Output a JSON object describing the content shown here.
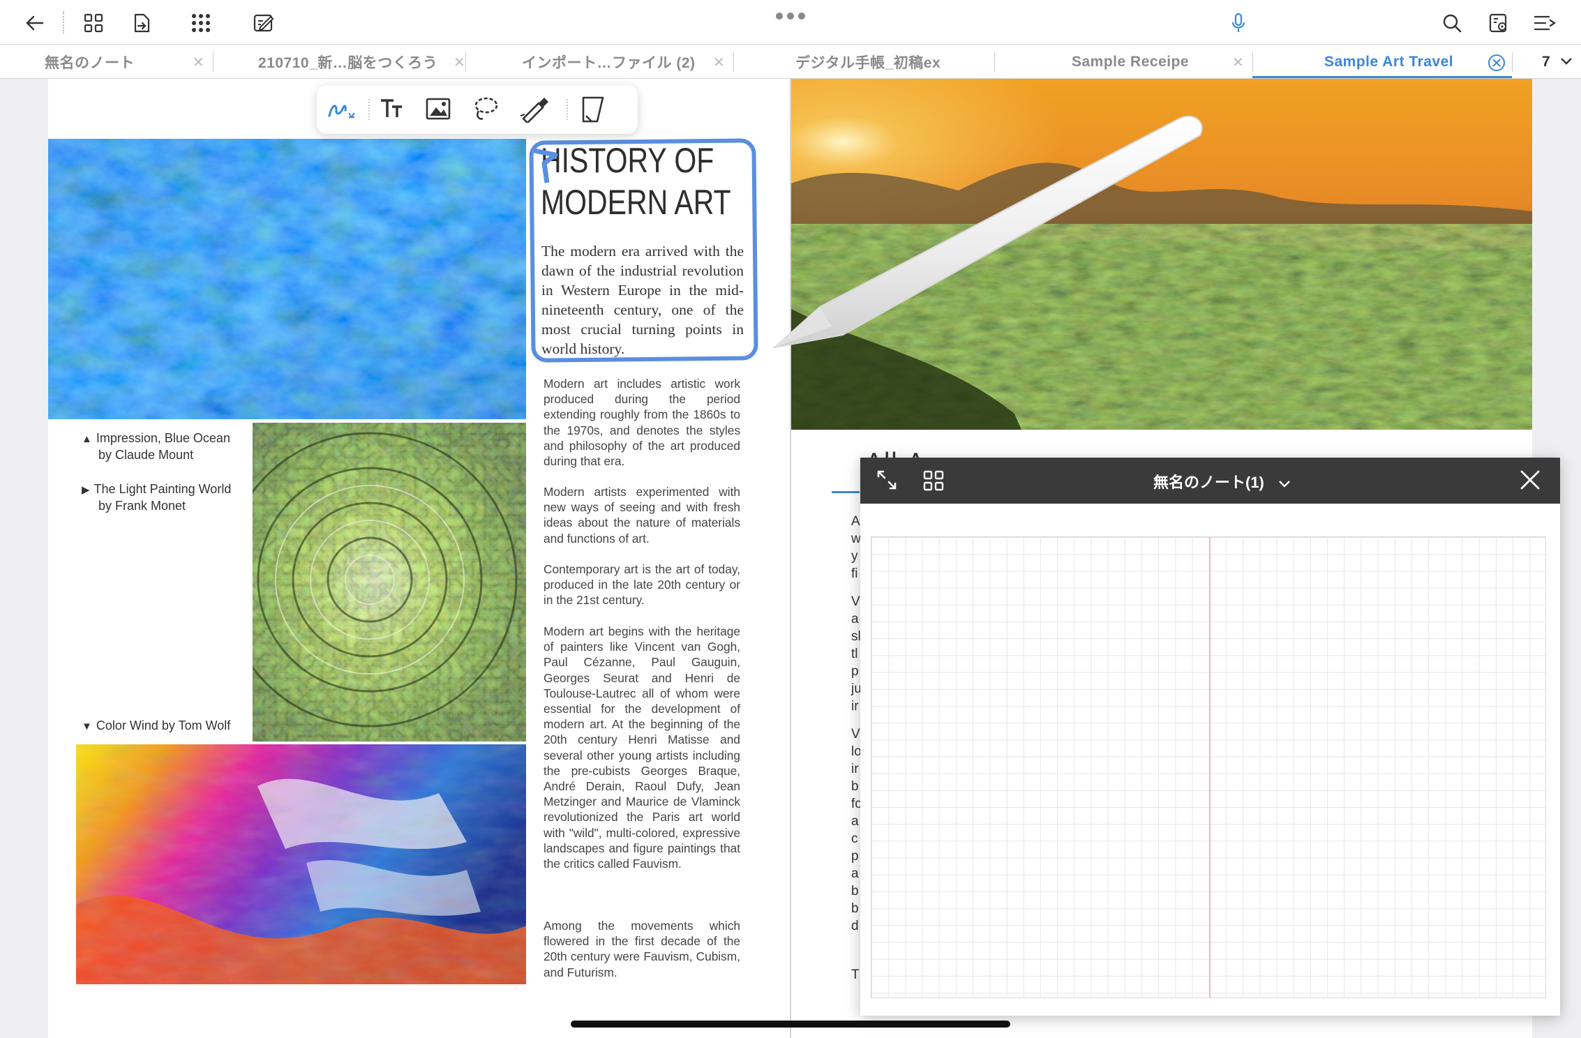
{
  "toolbar": {
    "back_icon": "arrow-left-icon",
    "grid_icon": "grid-view-icon",
    "export_icon": "file-export-icon",
    "apps_icon": "apps-dots-icon",
    "edit_icon": "edit-note-icon",
    "more_icon": "more-dots-icon",
    "mic_icon": "microphone-icon",
    "search_icon": "search-icon",
    "settings_icon": "page-settings-icon",
    "list_icon": "list-menu-icon",
    "accent": "#3a87d9"
  },
  "tabs": [
    {
      "label": "無名のノート"
    },
    {
      "label": "210710_新…脳をつくろう"
    },
    {
      "label": "インポート…ファイル (2)"
    },
    {
      "label": "デジタル手帳_初稿ex"
    },
    {
      "label": "Sample Receipe"
    },
    {
      "label": "Sample Art Travel",
      "active": true
    }
  ],
  "tab_count": "7",
  "pen_tools": [
    "pen-tool-icon",
    "text-tool-icon",
    "image-tool-icon",
    "lasso-tool-icon",
    "laser-pointer-icon",
    "eraser-tool-icon"
  ],
  "left_page": {
    "title_line1": "HISTORY OF",
    "title_line2": "MODERN ART",
    "lead": "The modern era arrived with the dawn of the industrial revolution in Western Europe in the mid-nineteenth century, one of the most crucial turning points in world history.",
    "paragraphs": [
      "Modern art includes artistic work produced during the period extending roughly from the 1860s to the 1970s, and denotes the styles and philosophy of the art produced during that era.",
      "Modern artists experimented with new ways of seeing and with fresh ideas about the nature of materials and functions of art.",
      "Contemporary art is the art of today, produced in the late 20th century or in the 21st century.",
      "Modern art begins with the heritage of painters like Vincent van Gogh, Paul Cézanne, Paul Gauguin, Georges Seurat and Henri de Toulouse-Lautrec all of whom were essential for the development of modern art. At the beginning of the 20th century Henri Matisse and several other young artists including the pre-cubists Georges Braque, André Derain, Raoul Dufy, Jean Metzinger and Maurice de Vlaminck revolutionized the Paris art world with \"wild\", multi-colored, expressive landscapes and figure paintings that the critics called Fauvism.",
      "Among the movements which flowered in the first decade of the 20th century were Fauvism, Cubism, and Futurism."
    ],
    "captions": [
      {
        "line1": "Impression, Blue Ocean",
        "line2": "by Claude Mount"
      },
      {
        "line1": "The Light Painting World",
        "line2": "by Frank Monet"
      },
      {
        "line1": "Color Wind by Tom Wolf",
        "line2": ""
      }
    ]
  },
  "right_page": {
    "text_fragments": [
      "A",
      "w",
      "y",
      "fi",
      "V",
      "a",
      "sl",
      "tl",
      "p",
      "ju",
      "ir",
      "V",
      "lo",
      "ir",
      "b",
      "fo",
      "a",
      "c",
      "p",
      "a",
      "b",
      "b",
      "d",
      "T"
    ]
  },
  "floating_panel": {
    "title": "無名のノート(1)",
    "expand_icon": "expand-icon",
    "grid_icon": "grid-view-icon",
    "chevron_icon": "chevron-down-icon",
    "close_icon": "close-icon"
  }
}
